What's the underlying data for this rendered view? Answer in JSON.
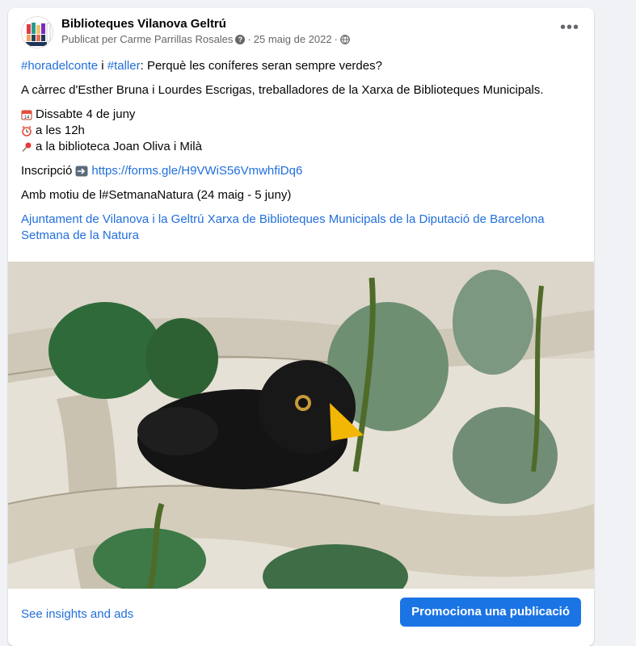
{
  "post": {
    "page_name": "Biblioteques Vilanova Geltrú",
    "published_by": "Publicat per Carme Parrillas Rosales",
    "date": "25 maig de 2022",
    "separator": "·",
    "more_icon": "more-options-icon",
    "privacy_icon": "globe-icon"
  },
  "content": {
    "hashtag1": "#horadelconte",
    "conj": " i ",
    "hashtag2": "#taller",
    "title_rest": ": Perquè les coníferes seran sempre verdes?",
    "credits": "A càrrec d'Esther Bruna i Lourdes Escrigas, treballadores de la Xarxa de Biblioteques Municipals.",
    "date_line": "Dissabte 4 de juny",
    "time_line": "a les 12h",
    "place_line": "a la biblioteca Joan Oliva i Milà",
    "signup_label": "Inscripció",
    "signup_link": "https://forms.gle/H9VWiS56VmwhfiDq6",
    "reason": "Amb motiu de l#SetmanaNatura (24 maig - 5 juny)",
    "tag1": "Ajuntament de Vilanova i la Geltrú",
    "tag2": "Xarxa de Biblioteques Municipals de la Diputació de Barcelona",
    "tag3": "Setmana de la Natura"
  },
  "footer": {
    "insights": "See insights and ads",
    "promote": "Promociona una publicació"
  },
  "colors": {
    "link": "#216fdb",
    "button": "#1b74e4"
  }
}
